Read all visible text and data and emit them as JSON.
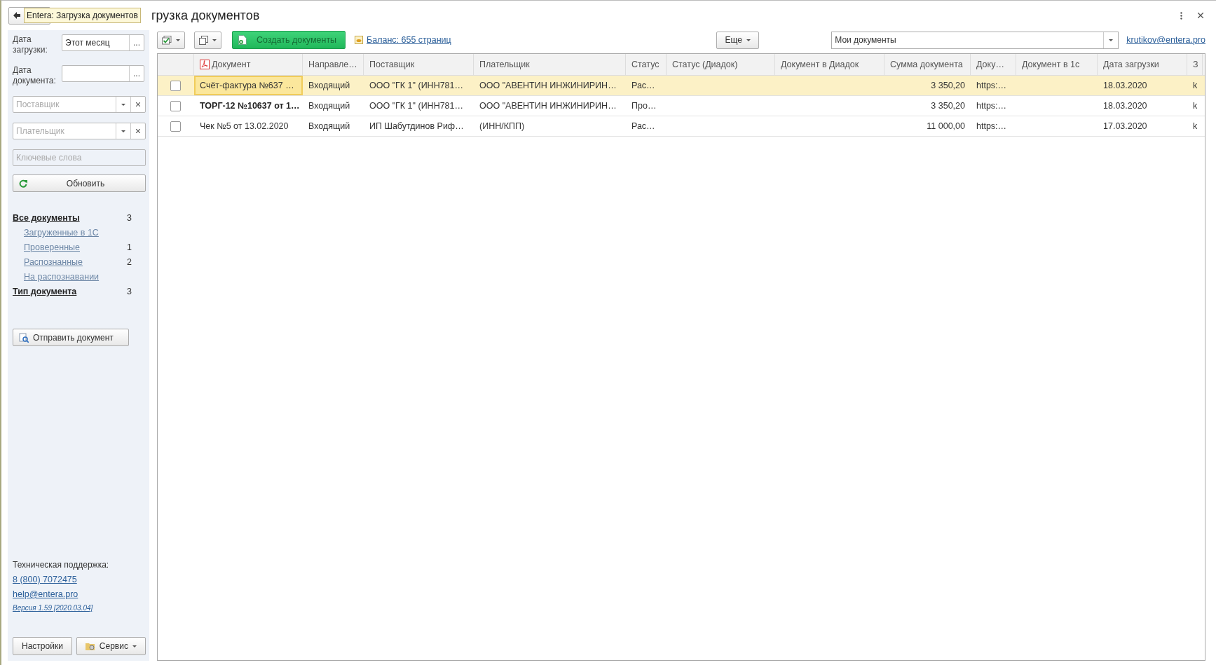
{
  "window": {
    "title": "грузка документов",
    "tooltip": "Entera: Загрузка документов"
  },
  "filters": [
    {
      "kind": "select",
      "label": "Дата загрузки:",
      "value": "Этот месяц",
      "button": "..."
    },
    {
      "kind": "select",
      "label": "Дата документа:",
      "button": "..."
    },
    {
      "kind": "combo",
      "placeholder": "Поставщик"
    },
    {
      "kind": "combo",
      "placeholder": "Плательщик"
    },
    {
      "kind": "text",
      "placeholder": "Ключевые слова"
    }
  ],
  "refresh_button": "Обновить",
  "nav": [
    {
      "label": "Все документы",
      "count": "3",
      "children": [
        {
          "label": "Загруженные в 1С"
        },
        {
          "label": "Проверенные",
          "count": "1"
        },
        {
          "label": "Распознанные",
          "count": "2"
        },
        {
          "label": "На распознавании"
        }
      ]
    },
    {
      "label": "Тип документа",
      "count": "3"
    }
  ],
  "send_button": "Отправить документ",
  "support": {
    "label": "Техническая поддержка:",
    "phone": "8 (800) 7072475",
    "email": "help@entera.pro",
    "version": "Версия 1.59 [2020.03.04]"
  },
  "footer_buttons": [
    {
      "kind": "plain",
      "label": "Настройки"
    },
    {
      "kind": "menu",
      "label": "Сервис"
    }
  ],
  "toolbar": {
    "create_button": "Создать документы",
    "balance": "Баланс: 655 страниц",
    "more_button": "Еще",
    "view": "Мои документы",
    "user": "krutikov@entera.pro"
  },
  "table": {
    "columns": [
      "",
      "Документ",
      "Направле…",
      "Поставщик",
      "Плательщик",
      "Статус",
      "Статус (Диадок)",
      "Документ в Диадок",
      "Сумма документа",
      "Доку…",
      "Документ в 1с",
      "Дата загрузки",
      "З"
    ],
    "rows": [
      {
        "selected": true,
        "unread": false,
        "checked": false,
        "cells": [
          "",
          "Счёт-фактура №637 …",
          "Входящий",
          "ООО \"ГК 1\" (ИНН781…",
          "ООО \"АВЕНТИН ИНЖИНИРИН…",
          "Рас…",
          "",
          "",
          "3 350,20",
          "https:…",
          "",
          "18.03.2020",
          "k"
        ]
      },
      {
        "selected": false,
        "unread": true,
        "checked": false,
        "cells": [
          "",
          "ТОРГ-12 №10637 от 1…",
          "Входящий",
          "ООО \"ГК 1\" (ИНН781…",
          "ООО \"АВЕНТИН ИНЖИНИРИН…",
          "Про…",
          "",
          "",
          "3 350,20",
          "https:…",
          "",
          "18.03.2020",
          "k"
        ]
      },
      {
        "selected": false,
        "unread": false,
        "checked": false,
        "cells": [
          "",
          "Чек №5 от 13.02.2020",
          "Входящий",
          "ИП Шабутдинов Риф…",
          " (ИНН/КПП)",
          "Рас…",
          "",
          "",
          "11 000,00",
          "https:…",
          "",
          "17.03.2020",
          "k"
        ]
      }
    ]
  }
}
